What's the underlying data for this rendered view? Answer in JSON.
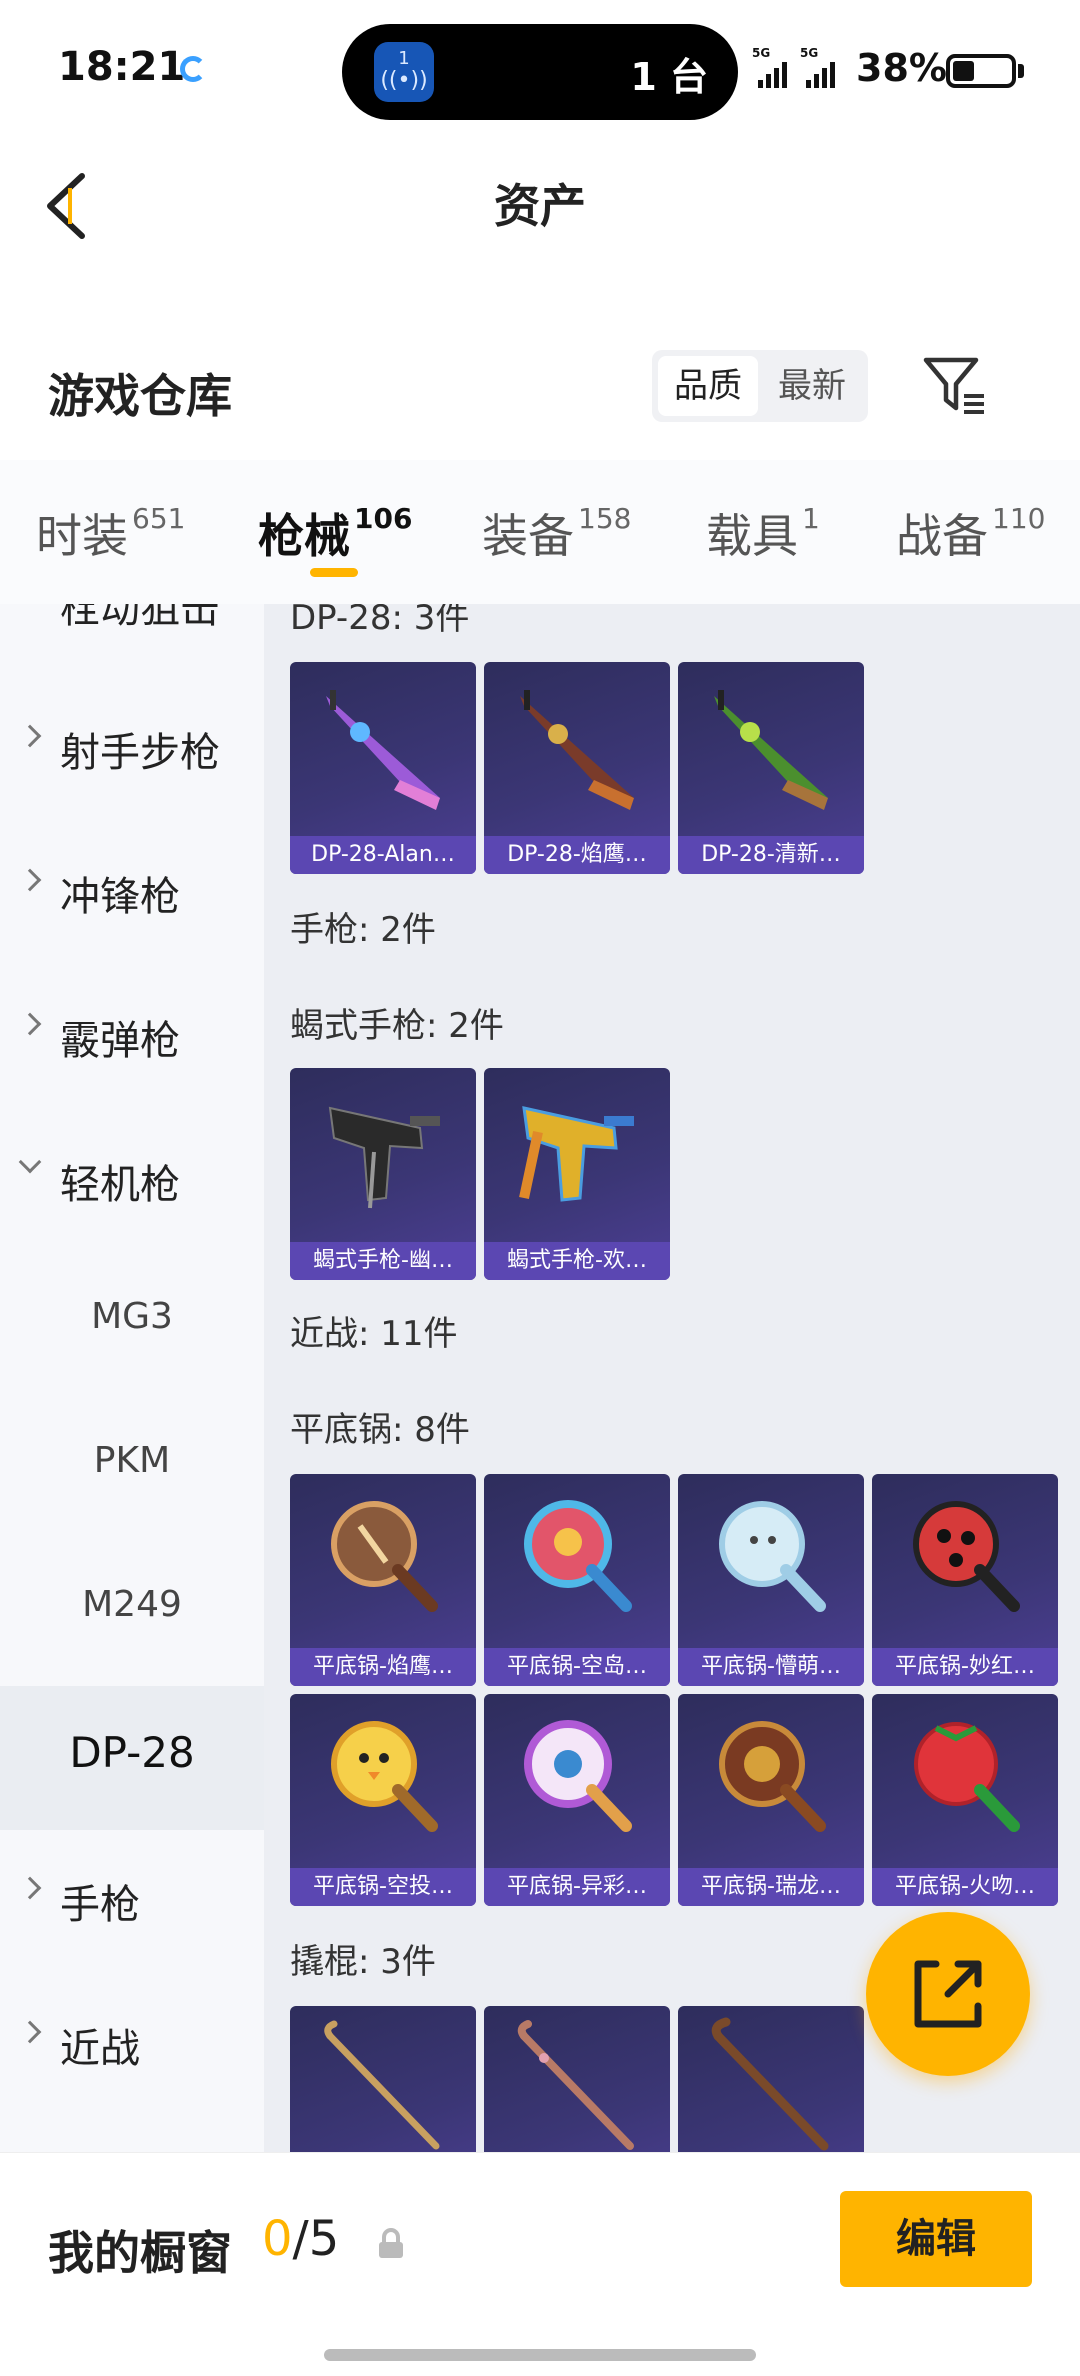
{
  "status_bar": {
    "time": "18:21",
    "island_icon_text": "1",
    "island_text": "1 台",
    "signal1_tag": "5G",
    "signal2_tag": "5G",
    "battery_percent": "38%",
    "battery_level": 0.38
  },
  "header": {
    "title": "资产",
    "back_icon": "chevron-left-icon"
  },
  "warehouse": {
    "title": "游戏仓库",
    "sort_options": [
      "品质",
      "最新"
    ],
    "selected_sort": "品质",
    "filter_icon": "filter-icon"
  },
  "tabs": [
    {
      "label": "时装",
      "count": "651",
      "active": false
    },
    {
      "label": "枪械",
      "count": "106",
      "active": true
    },
    {
      "label": "装备",
      "count": "158",
      "active": false
    },
    {
      "label": "载具",
      "count": "1",
      "active": false
    },
    {
      "label": "战备",
      "count": "110",
      "active": false
    }
  ],
  "sidebar": [
    {
      "label": "栓动狙击",
      "type": "category",
      "expanded": false
    },
    {
      "label": "射手步枪",
      "type": "category",
      "expanded": false
    },
    {
      "label": "冲锋枪",
      "type": "category",
      "expanded": false
    },
    {
      "label": "霰弹枪",
      "type": "category",
      "expanded": false
    },
    {
      "label": "轻机枪",
      "type": "category",
      "expanded": true
    },
    {
      "label": "MG3",
      "type": "sub"
    },
    {
      "label": "PKM",
      "type": "sub"
    },
    {
      "label": "M249",
      "type": "sub"
    },
    {
      "label": "DP-28",
      "type": "sub",
      "selected": true
    },
    {
      "label": "手枪",
      "type": "category",
      "expanded": false
    },
    {
      "label": "近战",
      "type": "category",
      "expanded": false
    }
  ],
  "content": {
    "sections": [
      {
        "label": "DP-28: 3件",
        "items": [
          "DP-28-Alan…",
          "DP-28-焰鹰…",
          "DP-28-清新…"
        ]
      },
      {
        "label": "手枪: 2件",
        "items": []
      },
      {
        "label": "蝎式手枪: 2件",
        "items": [
          "蝎式手枪-幽…",
          "蝎式手枪-欢…"
        ]
      },
      {
        "label": "近战: 11件",
        "items": []
      },
      {
        "label": "平底锅: 8件",
        "items": [
          "平底锅-焰鹰…",
          "平底锅-空岛…",
          "平底锅-懵萌…",
          "平底锅-妙红…",
          "平底锅-空投…",
          "平底锅-异彩…",
          "平底锅-瑞龙…",
          "平底锅-火吻…"
        ]
      },
      {
        "label": "撬棍: 3件",
        "items": [
          "",
          "",
          ""
        ]
      }
    ]
  },
  "fab": {
    "icon": "share-external-icon"
  },
  "bottom_bar": {
    "label": "我的橱窗",
    "count_current": "0",
    "count_total": "/5",
    "lock_icon": "lock-icon",
    "edit_label": "编辑"
  },
  "colors": {
    "accent": "#ffb400",
    "card_caption": "#5b47b2",
    "card_bg": "#3b3675"
  }
}
